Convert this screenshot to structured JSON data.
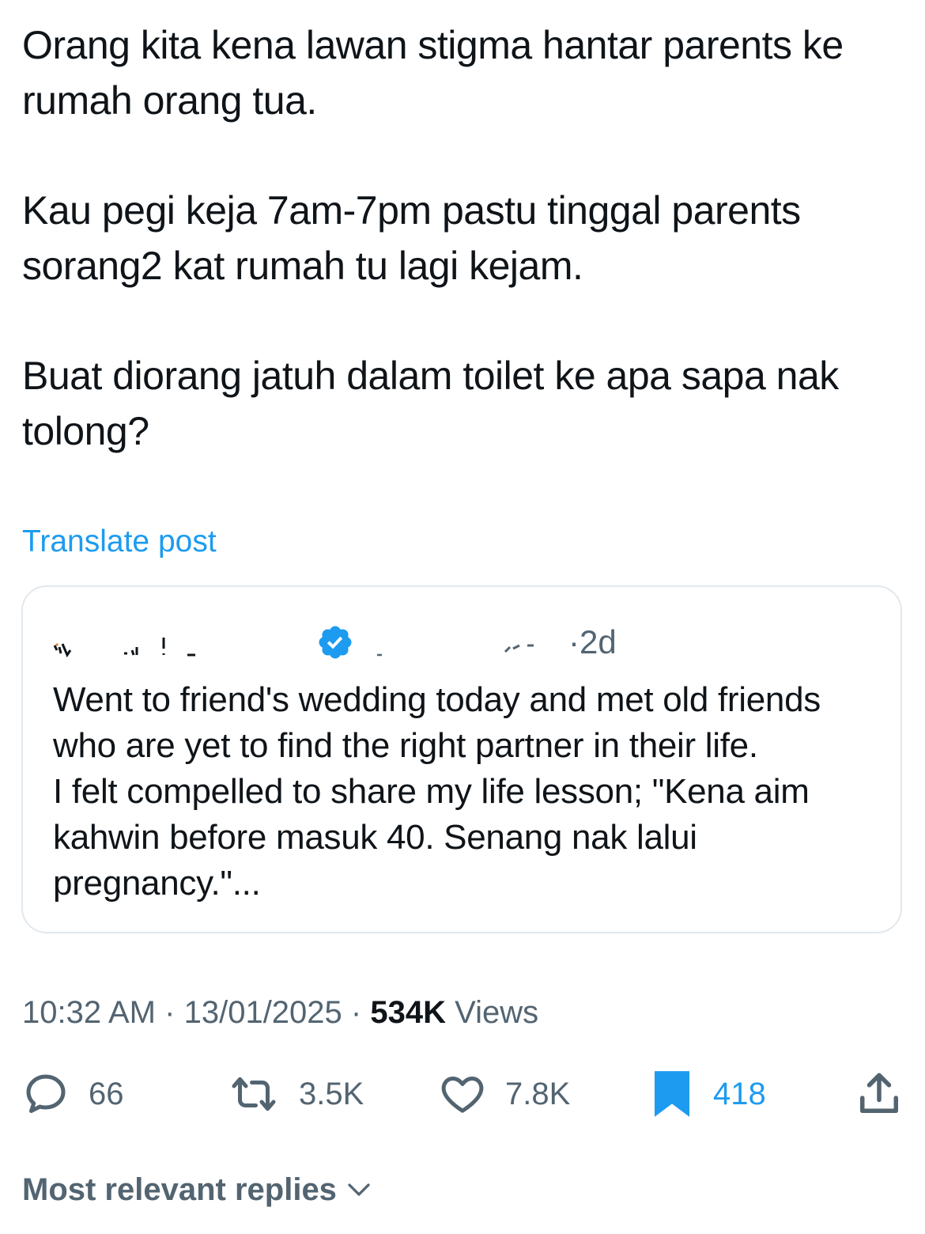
{
  "post": {
    "paragraphs": [
      "Orang kita kena lawan stigma hantar parents ke rumah orang tua.",
      "Kau pegi keja 7am-7pm pastu tinggal parents sorang2 kat rumah tu lagi kejam.",
      "Buat diorang jatuh dalam toilet ke apa sapa nak tolong?"
    ],
    "translate_label": "Translate post"
  },
  "quoted_post": {
    "time_ago": "·2d",
    "text": "Went to friend's wedding today and met old friends who are yet to find the right partner in their life.\nI felt compelled to share my life lesson; \"Kena aim kahwin before masuk 40. Senang nak lalui pregnancy.\"...",
    "verified_badge_color": "#1d9bf0"
  },
  "meta": {
    "time": "10:32 AM",
    "separator": "·",
    "date": "13/01/2025",
    "views_count": "534K",
    "views_label": "Views"
  },
  "actions": {
    "replies": "66",
    "reposts": "3.5K",
    "likes": "7.8K",
    "bookmarks": "418"
  },
  "icons": {
    "reply": "reply-icon",
    "repost": "repost-icon",
    "like": "heart-icon",
    "bookmark": "bookmark-icon",
    "share": "share-icon",
    "verified": "verified-badge-icon",
    "chevron": "chevron-down-icon"
  },
  "colors": {
    "accent": "#1d9bf0",
    "secondary_text": "#536471",
    "primary_text": "#0f1419",
    "border": "#e1e8ed"
  },
  "replies_sort": {
    "label": "Most relevant replies"
  }
}
